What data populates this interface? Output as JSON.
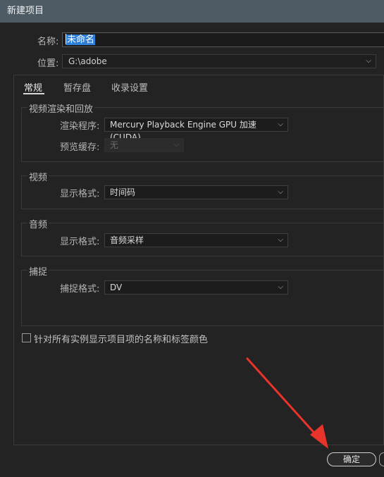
{
  "window": {
    "title": "新建项目"
  },
  "project": {
    "name_label": "名称:",
    "name_value": "未命名",
    "location_label": "位置:",
    "location_value": "G:\\adobe"
  },
  "tabs": [
    {
      "label": "常规",
      "active": true
    },
    {
      "label": "暂存盘",
      "active": false
    },
    {
      "label": "收录设置",
      "active": false
    }
  ],
  "video_rendering": {
    "title": "视频渲染和回放",
    "renderer_label": "渲染程序:",
    "renderer_value": "Mercury Playback Engine GPU 加速 (CUDA)",
    "preview_cache_label": "预览缓存:",
    "preview_cache_value": "无"
  },
  "video": {
    "title": "视频",
    "display_format_label": "显示格式:",
    "display_format_value": "时间码"
  },
  "audio": {
    "title": "音频",
    "display_format_label": "显示格式:",
    "display_format_value": "音频采样"
  },
  "capture": {
    "title": "捕捉",
    "capture_format_label": "捕捉格式:",
    "capture_format_value": "DV"
  },
  "options": {
    "show_names_colors_label": "针对所有实例显示项目项的名称和标签颜色",
    "show_names_colors_checked": false
  },
  "buttons": {
    "ok_label": "确定"
  },
  "annotation": {
    "arrow_color": "#e8342a"
  }
}
